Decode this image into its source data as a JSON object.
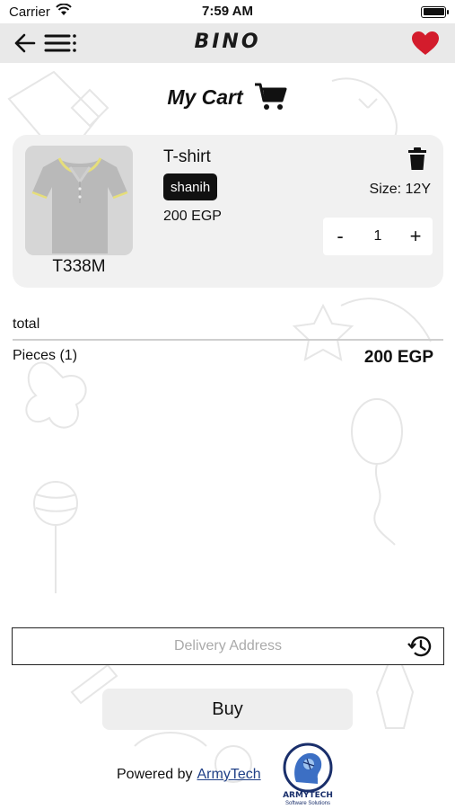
{
  "status_bar": {
    "carrier": "Carrier",
    "time": "7:59 AM"
  },
  "nav": {
    "logo": "BINO"
  },
  "cart": {
    "title": "My Cart"
  },
  "items": [
    {
      "code": "T338M",
      "name": "T-shirt",
      "color": "shanih",
      "price": "200 EGP",
      "size": "Size: 12Y",
      "quantity": "1",
      "decrement": "-",
      "increment": "+"
    }
  ],
  "totals": {
    "label": "total",
    "pieces": "Pieces (1)",
    "amount": "200 EGP"
  },
  "delivery": {
    "placeholder": "Delivery Address"
  },
  "actions": {
    "buy": "Buy"
  },
  "footer": {
    "powered_by": "Powered by",
    "company": "ArmyTech",
    "logo_text": "ARMYTECH",
    "logo_sub": "Software Solutions"
  },
  "colors": {
    "favorite": "#d31c2c",
    "nav_bg": "#e9e9e9",
    "card_bg": "#f1f1f1",
    "link": "#1f3f86"
  },
  "icons": [
    "wifi-icon",
    "battery-icon",
    "back-arrow-icon",
    "menu-icon",
    "heart-icon",
    "cart-icon",
    "trash-icon",
    "history-icon"
  ]
}
